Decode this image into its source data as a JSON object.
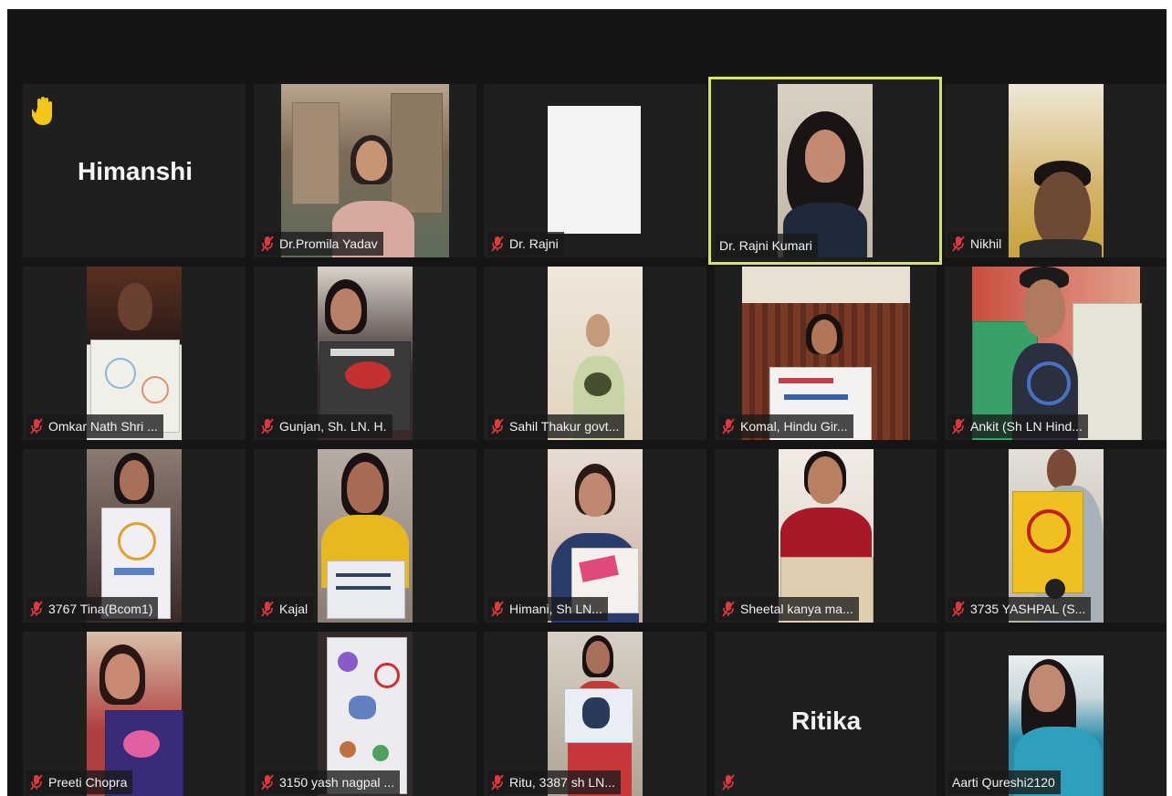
{
  "participants": [
    {
      "name": "Himanshi",
      "label_style": "big",
      "hand_raised": true
    },
    {
      "name": "Dr.Promila Yadav",
      "muted": true
    },
    {
      "name": "Dr. Rajni",
      "muted": true
    },
    {
      "name": "Dr. Rajni Kumari",
      "muted": false,
      "active_speaker": true
    },
    {
      "name": "Nikhil",
      "muted": true
    },
    {
      "name": "Omkar Nath Shri ...",
      "muted": true
    },
    {
      "name": "Gunjan, Sh. LN. H.",
      "muted": true
    },
    {
      "name": "Sahil Thakur govt...",
      "muted": true
    },
    {
      "name": "Komal, Hindu Gir...",
      "muted": true
    },
    {
      "name": "Ankit (Sh LN Hind...",
      "muted": true
    },
    {
      "name": "3767 Tina(Bcom1)",
      "muted": true
    },
    {
      "name": "Kajal",
      "muted": true
    },
    {
      "name": "Himani, Sh LN...",
      "muted": true
    },
    {
      "name": "Sheetal kanya ma...",
      "muted": true
    },
    {
      "name": "3735 YASHPAL (S...",
      "muted": true
    },
    {
      "name": "Preeti Chopra",
      "muted": true
    },
    {
      "name": "3150 yash nagpal ...",
      "muted": true
    },
    {
      "name": "Ritu, 3387 sh LN...",
      "muted": true
    },
    {
      "name": "Ritika",
      "label_style": "big",
      "muted": true
    },
    {
      "name": "Aarti Qureshi2120",
      "muted": false
    }
  ],
  "icons": {
    "muted": "muted-mic-icon",
    "hand": "raised-hand-icon"
  },
  "colors": {
    "active_speaker_border": "#d9e36a",
    "muted_mic": "#e0393b",
    "hand": "#f5c518",
    "background": "#151515"
  }
}
